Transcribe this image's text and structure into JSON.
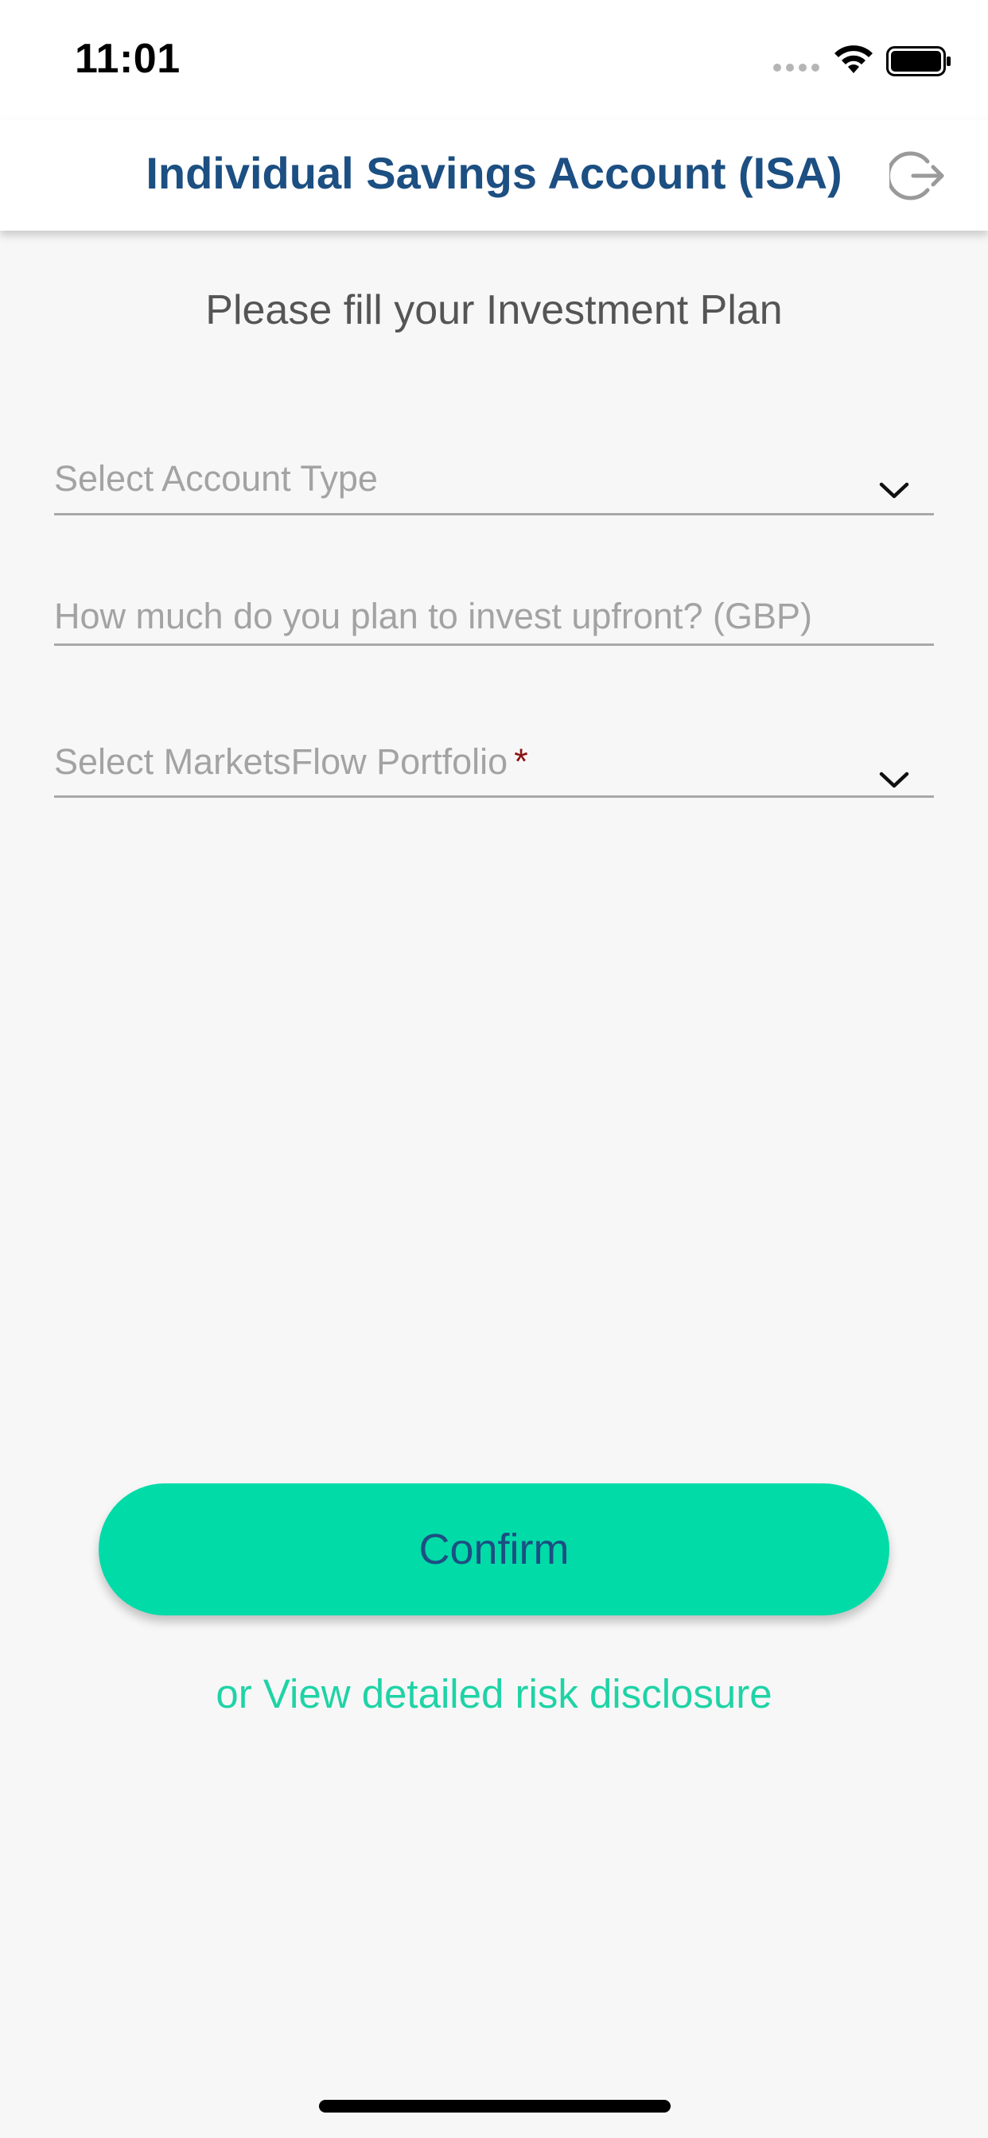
{
  "status_bar": {
    "time": "11:01"
  },
  "header": {
    "title": "Individual Savings Account (ISA)",
    "logout_icon": "logout-icon"
  },
  "form": {
    "intro": "Please fill your Investment Plan",
    "account_type": {
      "placeholder": "Select Account Type",
      "value": ""
    },
    "upfront_amount": {
      "placeholder": "How much do you plan to invest upfront? (GBP)",
      "value": ""
    },
    "portfolio": {
      "placeholder": "Select MarketsFlow Portfolio",
      "required_marker": "*",
      "value": ""
    }
  },
  "actions": {
    "confirm_label": "Confirm",
    "risk_link": "or View detailed risk disclosure"
  },
  "colors": {
    "title": "#1c4f82",
    "accent": "#00dba8",
    "link": "#1fd3a6",
    "required": "#8b1414",
    "background": "#f7f7f7"
  }
}
